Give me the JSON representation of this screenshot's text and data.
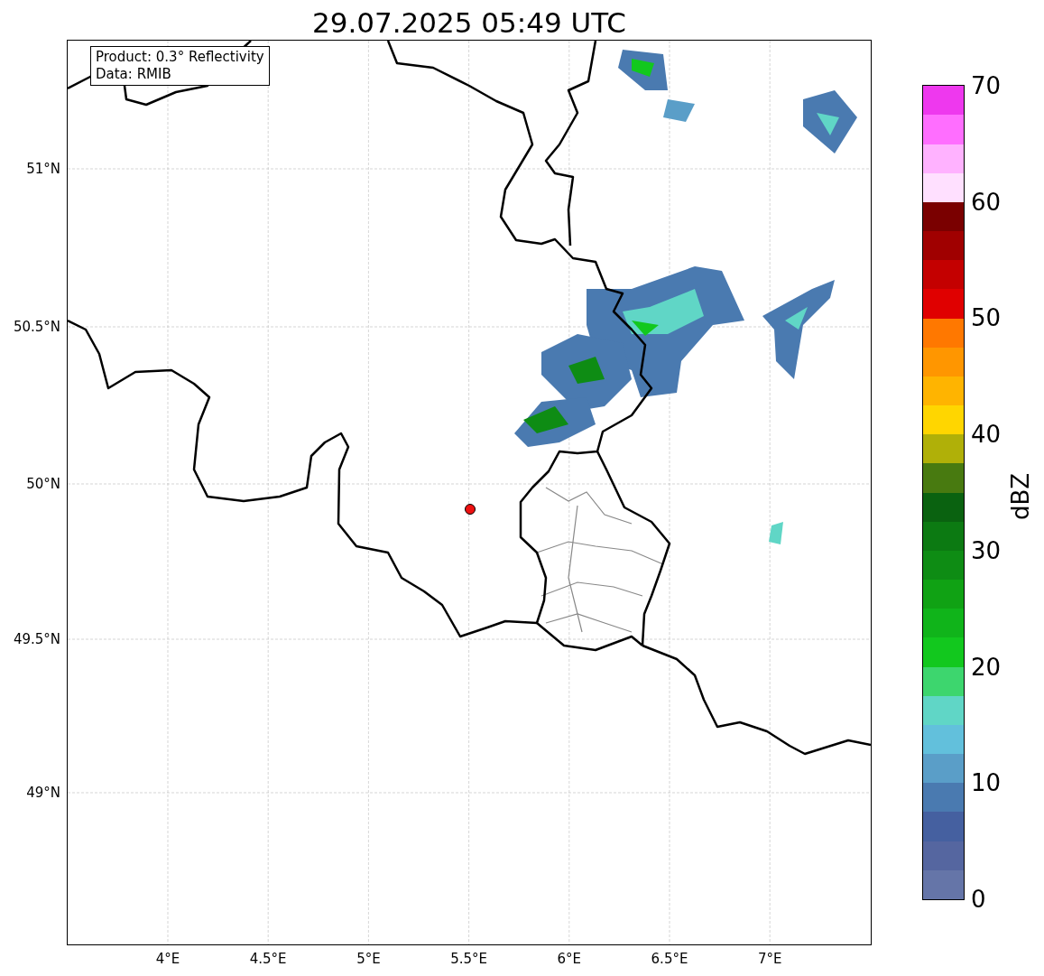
{
  "title": "29.07.2025 05:49 UTC",
  "info_box": [
    "Product: 0.3° Reflectivity",
    "Data: RMIB"
  ],
  "x_ticks": [
    "4°E",
    "4.5°E",
    "5°E",
    "5.5°E",
    "6°E",
    "6.5°E",
    "7°E"
  ],
  "y_ticks": [
    "51°N",
    "50.5°N",
    "50°N",
    "49.5°N",
    "49°N"
  ],
  "colorbar": {
    "label": "dBZ",
    "ticks": [
      "70",
      "60",
      "50",
      "40",
      "30",
      "20",
      "10",
      "0"
    ],
    "segments": [
      {
        "color": "#6575a8"
      },
      {
        "color": "#5566a0"
      },
      {
        "color": "#4560a0"
      },
      {
        "color": "#4a7ab0"
      },
      {
        "color": "#5a9ec8"
      },
      {
        "color": "#62c0dc"
      },
      {
        "color": "#60d6c6"
      },
      {
        "color": "#3dd66e"
      },
      {
        "color": "#12c81e"
      },
      {
        "color": "#10b41a"
      },
      {
        "color": "#10a214"
      },
      {
        "color": "#0e8c14"
      },
      {
        "color": "#0c7a12"
      },
      {
        "color": "#0a6210"
      },
      {
        "color": "#487a10"
      },
      {
        "color": "#b0b008"
      },
      {
        "color": "#ffd600"
      },
      {
        "color": "#ffb400"
      },
      {
        "color": "#ff9600"
      },
      {
        "color": "#ff7800"
      },
      {
        "color": "#e00000"
      },
      {
        "color": "#c40000"
      },
      {
        "color": "#a00000"
      },
      {
        "color": "#7a0000"
      },
      {
        "color": "#ffe0ff"
      },
      {
        "color": "#ffb2ff"
      },
      {
        "color": "#ff6eff"
      },
      {
        "color": "#ee38ee"
      }
    ]
  }
}
